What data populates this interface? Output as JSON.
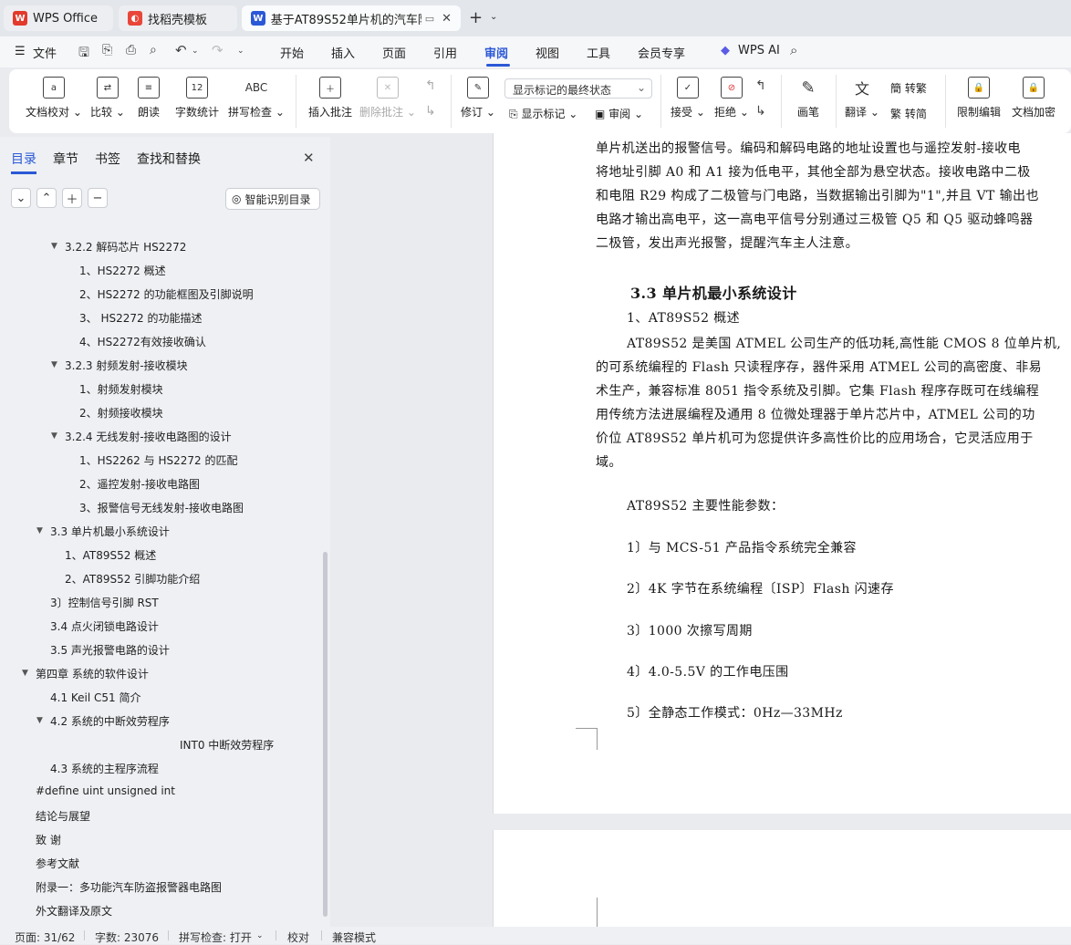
{
  "tabs": [
    {
      "label": "WPS Office"
    },
    {
      "label": "找稻壳模板"
    },
    {
      "label": "基于AT89S52单片机的汽车防"
    }
  ],
  "menu": [
    "文件",
    "开始",
    "插入",
    "页面",
    "引用",
    "审阅",
    "视图",
    "工具",
    "会员专享",
    "WPS AI"
  ],
  "ribbon": {
    "buttons": [
      "文档校对",
      "比较",
      "朗读",
      "字数统计",
      "拼写检查",
      "插入批注",
      "删除批注",
      "修订",
      "显示标记",
      "审阅",
      "接受",
      "拒绝",
      "画笔",
      "翻译",
      "转繁",
      "转简",
      "限制编辑",
      "文档加密"
    ],
    "icons": {
      "spell": "ABC",
      "wordcount": "12"
    },
    "track_state": "显示标记的最终状态"
  },
  "sidebar": {
    "tabs": [
      "目录",
      "章节",
      "书签",
      "查找和替换"
    ],
    "smart_button": "智能识别目录",
    "toc": [
      "3.2.2  解码芯片 HS2272",
      "1、HS2272 概述",
      "2、HS2272 的功能框图及引脚说明",
      "3、  HS2272 的功能描述",
      "4、HS2272有效接收确认",
      "3.2.3  射频发射-接收模块",
      "1、射频发射模块",
      "2、射频接收模块",
      "3.2.4  无线发射-接收电路图的设计",
      "1、HS2262 与 HS2272 的匹配",
      "2、遥控发射-接收电路图",
      "3、报警信号无线发射-接收电路图",
      "3.3  单片机最小系统设计",
      "1、AT89S52 概述",
      "2、AT89S52 引脚功能介绍",
      "3〕控制信号引脚 RST",
      "3.4  点火闭锁电路设计",
      "3.5  声光报警电路的设计",
      "第四章  系统的软件设计",
      "4.1 Keil  C51 简介",
      "4.2  系统的中断效劳程序",
      "INT0 中断效劳程序",
      "4.3  系统的主程序流程",
      "#define uint unsigned int",
      "结论与展望",
      "致  谢",
      "参考文献",
      "附录一：多功能汽车防盗报警器电路图",
      "外文翻译及原文"
    ]
  },
  "document": {
    "lines": [
      "单片机送出的报警信号。编码和解码电路的地址设置也与遥控发射-接收电",
      "将地址引脚 A0 和 A1 接为低电平，其他全部为悬空状态。接收电路中二极",
      "和电阻 R29  构成了二极管与门电路，当数据输出引脚为\"1\",并且 VT 输出也",
      "电路才输出高电平，这一高电平信号分别通过三极管 Q5 和 Q5 驱动蜂鸣器",
      "二极管，发出声光报警，提醒汽车主人注意。"
    ],
    "heading": "3.3  单片机最小系统设计",
    "subheading": "1、AT89S52 概述",
    "para": [
      "AT89S52 是美国 ATMEL 公司生产的低功耗,高性能 CMOS 8 位单片机,",
      "的可系统编程的 Flash 只读程序存，器件采用 ATMEL 公司的高密度、非易",
      "术生产，兼容标准 8051 指令系统及引脚。它集 Flash 程序存既可在线编程",
      "用传统方法进展编程及通用 8 位微处理器于单片芯片中，ATMEL 公司的功",
      "价位 AT89S52 单片机可为您提供许多高性价比的应用场合，它灵活应用于",
      "域。"
    ],
    "params_title": "AT89S52 主要性能参数：",
    "params": [
      "1〕与 MCS-51 产品指令系统完全兼容",
      "2〕4K 字节在系统编程〔ISP〕Flash 闪速存",
      "3〕1000 次擦写周期",
      "4〕4.0-5.5V 的工作电压围",
      "5〕全静态工作模式：0Hz—33MHz"
    ]
  },
  "status": {
    "page": "页面: 31/62",
    "words": "字数: 23076",
    "spell": "拼写检查: 打开",
    "proof": "校对",
    "compat": "兼容模式"
  }
}
